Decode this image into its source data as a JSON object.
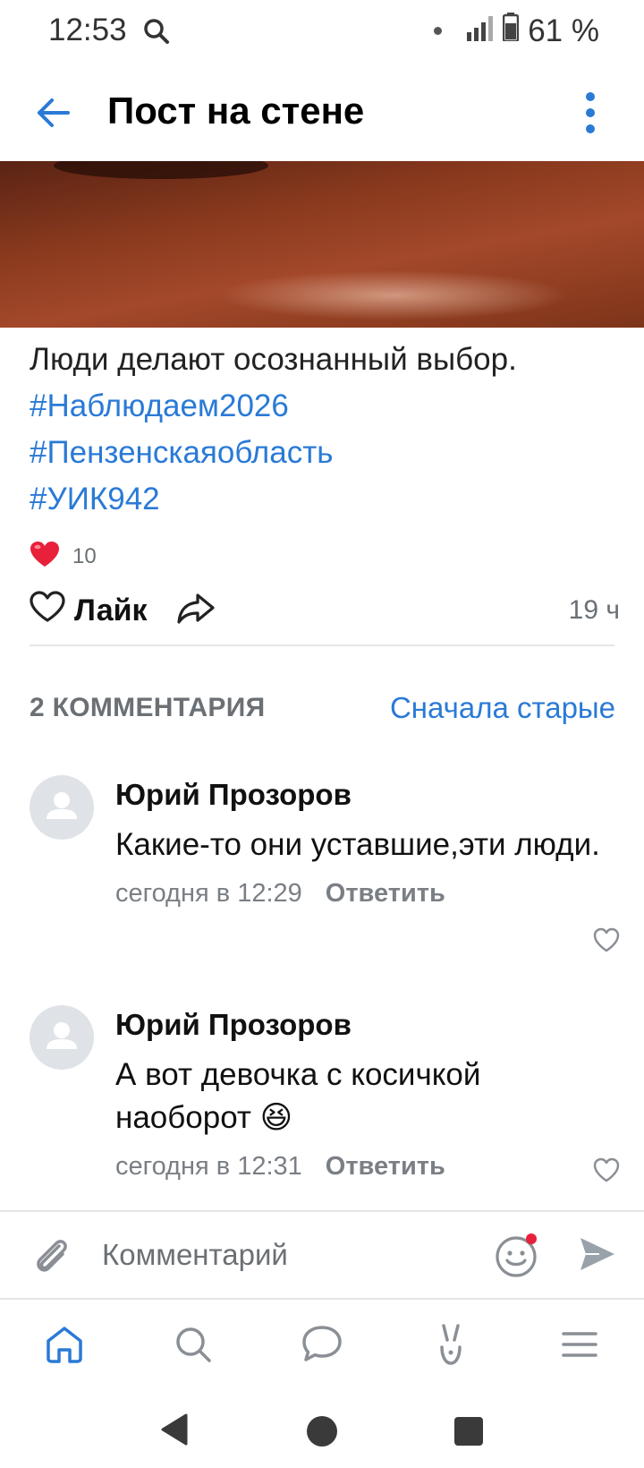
{
  "status_bar": {
    "time": "12:53",
    "battery": "61 %"
  },
  "header": {
    "title": "Пост на стене"
  },
  "post": {
    "text": "Люди делают осознанный выбор.",
    "hashtags": [
      "#Наблюдаем2026",
      "#Пензенскаяобласть",
      "#УИК942"
    ],
    "reactions_count": "10",
    "like_label": "Лайк",
    "time_ago": "19 ч"
  },
  "comments_section": {
    "count_label": "2 КОММЕНТАРИЯ",
    "sort_label": "Сначала старые",
    "items": [
      {
        "author": "Юрий Прозоров",
        "text": "Какие-то они уставшие,эти люди.",
        "time": "сегодня в 12:29",
        "reply_label": "Ответить"
      },
      {
        "author": "Юрий Прозоров",
        "text": "А вот девочка с косичкой наоборот 😆",
        "time": "сегодня в 12:31",
        "reply_label": "Ответить"
      }
    ]
  },
  "comment_input": {
    "placeholder": "Комментарий"
  },
  "colors": {
    "accent": "#2a7ad6",
    "secondary_text": "#6b7075",
    "heart_red": "#e8203a"
  },
  "icons": {
    "status": [
      "search-icon",
      "signal-icon",
      "battery-icon"
    ],
    "header": [
      "arrow-back-icon",
      "more-vertical-icon"
    ],
    "post_actions": [
      "heart-outline-icon",
      "share-icon"
    ],
    "tabbar": [
      "home-icon",
      "search-icon",
      "messages-icon",
      "clips-icon",
      "menu-icon"
    ],
    "system_nav": [
      "back-triangle-icon",
      "home-circle-icon",
      "recents-square-icon"
    ]
  }
}
